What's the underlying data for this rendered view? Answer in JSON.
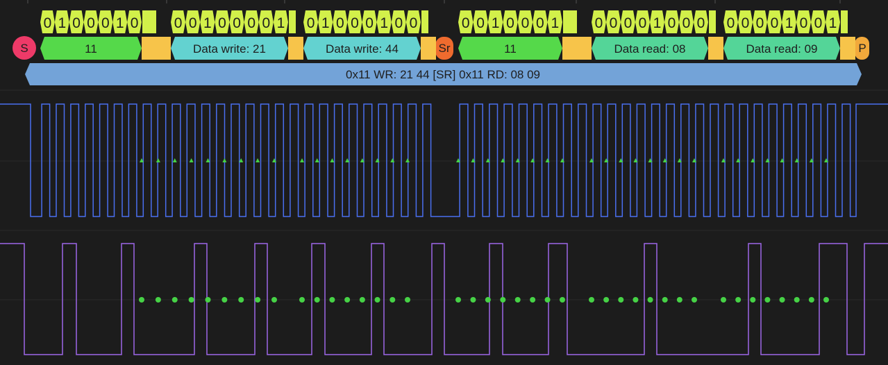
{
  "colors": {
    "background": "#1c1c1c",
    "grid": "#2a2a2a",
    "bits": "#d2f04a",
    "address": "#55d94a",
    "ack": "#f7c44a",
    "data_write": "#63d2d0",
    "data_read": "#54d598",
    "start": "#ee3a68",
    "repeated_start": "#ef6b2e",
    "stop": "#f2a93b",
    "summary": "#73a3d8",
    "scl_trace": "#4a6ff0",
    "sda_trace": "#9d66e8",
    "sample_marker": "#46d246"
  },
  "decoder": {
    "bytes": [
      {
        "id": "address-write",
        "bits": "0100010",
        "label": "11"
      },
      {
        "id": "data-write-1",
        "bits": "00100001",
        "label": "Data write: 21"
      },
      {
        "id": "data-write-2",
        "bits": "01000100",
        "label": "Data write: 44"
      },
      {
        "id": "address-read",
        "bits": "0010001",
        "label": "11"
      },
      {
        "id": "data-read-1",
        "bits": "00001000",
        "label": "Data read: 08"
      },
      {
        "id": "data-read-2",
        "bits": "00001001",
        "label": "Data read: 09"
      }
    ],
    "start_label": "S",
    "repeated_start_label": "Sr",
    "stop_label": "P",
    "summary": "0x11 WR: 21 44 [SR] 0x11 RD: 08 09"
  }
}
